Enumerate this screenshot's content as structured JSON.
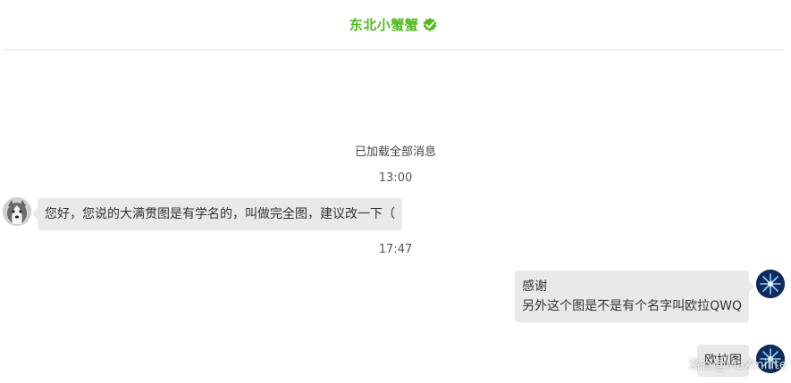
{
  "header": {
    "title": "东北小蟹蟹",
    "verified_icon": "verified-badge-icon",
    "accent_color": "#52b920"
  },
  "chat": {
    "loaded_notice": "已加载全部消息",
    "messages": [
      {
        "type": "timestamp",
        "text": "13:00"
      },
      {
        "type": "message",
        "side": "left",
        "avatar": "husky-dog-avatar",
        "lines": [
          "您好，您说的大满贯图是有学名的，叫做完全图，建议改一下（"
        ]
      },
      {
        "type": "timestamp",
        "text": "17:47"
      },
      {
        "type": "message",
        "side": "right",
        "avatar": "blue-flower-avatar",
        "lines": [
          "感谢",
          "另外这个图是不是有个名字叫欧拉QWQ"
        ]
      },
      {
        "type": "message",
        "side": "right",
        "avatar": "blue-flower-avatar",
        "lines": [
          "欧拉图"
        ]
      }
    ]
  },
  "watermark": "洛谷@Maxmilite"
}
